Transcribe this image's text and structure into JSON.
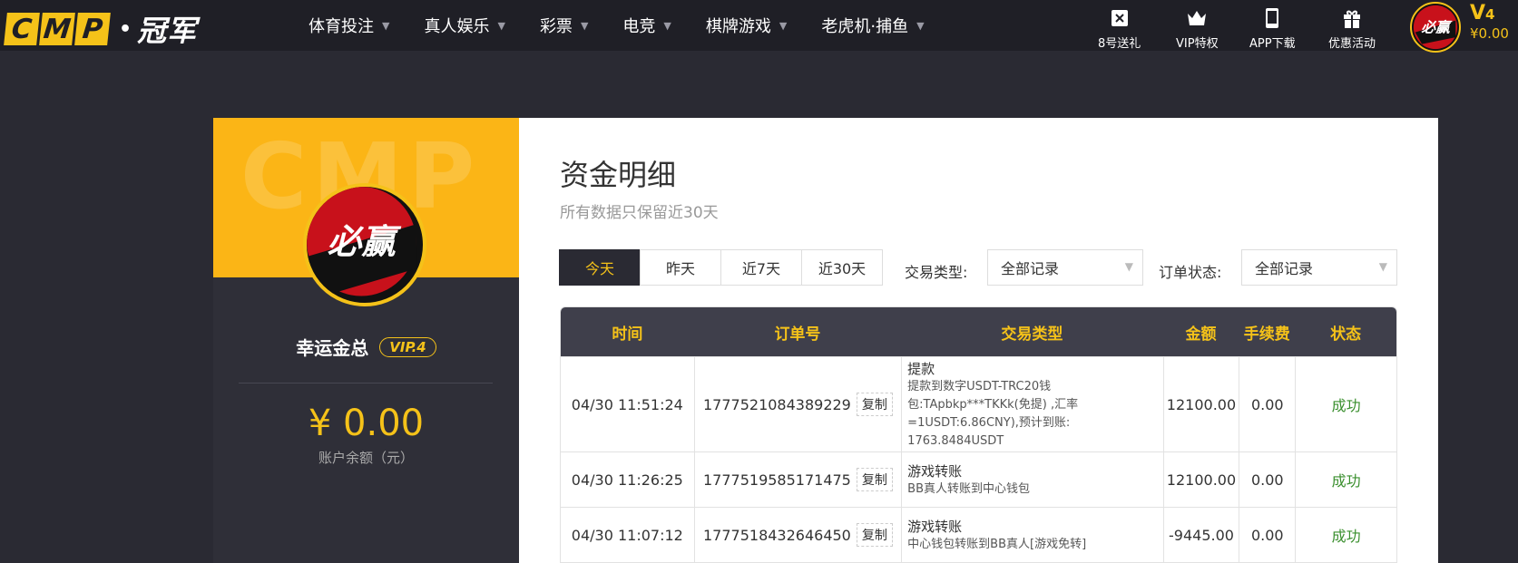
{
  "header": {
    "logo_letters": [
      "C",
      "M",
      "P"
    ],
    "logo_cn": "冠军",
    "nav": [
      {
        "label": "体育投注"
      },
      {
        "label": "真人娱乐"
      },
      {
        "label": "彩票"
      },
      {
        "label": "电竞"
      },
      {
        "label": "棋牌游戏"
      },
      {
        "label": "老虎机·捕鱼"
      }
    ],
    "quick_links": [
      {
        "label": "8号送礼",
        "icon": "ticket-icon"
      },
      {
        "label": "VIP特权",
        "icon": "crown-icon"
      },
      {
        "label": "APP下载",
        "icon": "phone-icon"
      },
      {
        "label": "优惠活动",
        "icon": "gift-icon"
      }
    ],
    "vip_prefix": "V",
    "vip_level": "4",
    "balance": "¥0.00"
  },
  "user": {
    "watermark": "CMP",
    "avatar_text": "必赢",
    "name": "幸运金总",
    "vip_tag": "VIP.4",
    "balance": "¥ 0.00",
    "balance_label": "账户余额（元）"
  },
  "main": {
    "title": "资金明细",
    "subtitle": "所有数据只保留近30天",
    "tabs": [
      {
        "label": "今天",
        "active": true
      },
      {
        "label": "昨天",
        "active": false
      },
      {
        "label": "近7天",
        "active": false
      },
      {
        "label": "近30天",
        "active": false
      }
    ],
    "filter_type": {
      "label": "交易类型:",
      "value": "全部记录"
    },
    "filter_status": {
      "label": "订单状态:",
      "value": "全部记录"
    },
    "columns": [
      "时间",
      "订单号",
      "交易类型",
      "金额",
      "手续费",
      "状态"
    ],
    "copy_label": "复制",
    "rows": [
      {
        "time": "04/30 11:51:24",
        "order": "1777521084389229",
        "type_title": "提款",
        "type_desc": [
          "提款到数字USDT-TRC20钱",
          "包:TApbkp***TKKk(免提) ,汇率",
          "=1USDT:6.86CNY),预计到账:",
          "1763.8484USDT"
        ],
        "amount": "12100.00",
        "fee": "0.00",
        "status": "成功"
      },
      {
        "time": "04/30 11:26:25",
        "order": "1777519585171475",
        "type_title": "游戏转账",
        "type_desc": [
          "BB真人转账到中心钱包"
        ],
        "amount": "12100.00",
        "fee": "0.00",
        "status": "成功"
      },
      {
        "time": "04/30 11:07:12",
        "order": "1777518432646450",
        "type_title": "游戏转账",
        "type_desc": [
          "中心钱包转账到BB真人[游戏免转]"
        ],
        "amount": "-9445.00",
        "fee": "0.00",
        "status": "成功"
      }
    ]
  },
  "colors": {
    "accent": "#f5c219",
    "dark_bg": "#2a2a33",
    "topbar_bg": "#1f1f26",
    "table_header": "#3f3f4b",
    "success": "#3a8f2e"
  }
}
